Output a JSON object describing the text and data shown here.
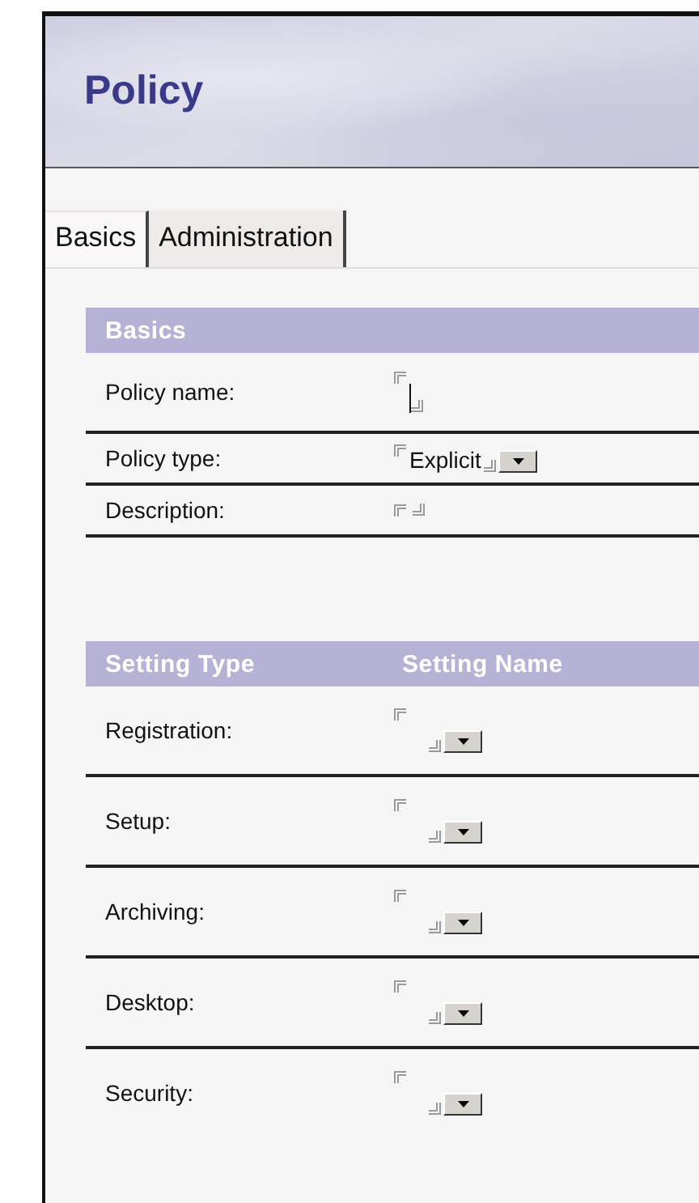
{
  "header": {
    "title": "Policy"
  },
  "tabs": [
    {
      "label": "Basics",
      "selected": true
    },
    {
      "label": "Administration",
      "selected": false
    }
  ],
  "basics": {
    "heading": "Basics",
    "fields": [
      {
        "label": "Policy name:",
        "kind": "text",
        "focused": true
      },
      {
        "label": "Policy type:",
        "kind": "dropdown",
        "value": "Explicit"
      },
      {
        "label": "Description:",
        "kind": "text"
      }
    ]
  },
  "settings": {
    "columns": [
      "Setting Type",
      "Setting Name"
    ],
    "rows": [
      {
        "label": "Registration:",
        "kind": "dropdown"
      },
      {
        "label": "Setup:",
        "kind": "dropdown"
      },
      {
        "label": "Archiving:",
        "kind": "dropdown"
      },
      {
        "label": "Desktop:",
        "kind": "dropdown"
      },
      {
        "label": "Security:",
        "kind": "dropdown"
      }
    ]
  }
}
